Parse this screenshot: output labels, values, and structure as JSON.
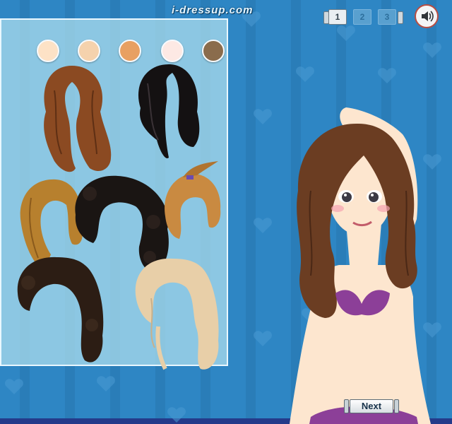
{
  "site": {
    "title": "i-dressup.com"
  },
  "skin_swatches": [
    {
      "color": "#fde2c6"
    },
    {
      "color": "#f5d2ad"
    },
    {
      "color": "#e8a062"
    },
    {
      "color": "#fde9e4"
    },
    {
      "color": "#8a6c4c"
    }
  ],
  "hair_options": [
    {
      "color": "#8b4a22"
    },
    {
      "color": "#141112"
    },
    {
      "color": "#b7802e"
    },
    {
      "color": "#1a1513"
    },
    {
      "color": "#c98a41"
    },
    {
      "color": "#2c1d14"
    },
    {
      "color": "#e8cfa8"
    }
  ],
  "pagination": {
    "pages": [
      "1",
      "2",
      "3"
    ],
    "current": "1"
  },
  "next_button": {
    "label": "Next"
  },
  "colors": {
    "background": "#2e86c4",
    "panel": "#b2e0ee",
    "sound_ring": "#b74d42",
    "model_hair": "#6b3d22",
    "model_skin": "#fde6cf",
    "bikini": "#8c3f98"
  },
  "icons": {
    "sound": "speaker-icon"
  }
}
